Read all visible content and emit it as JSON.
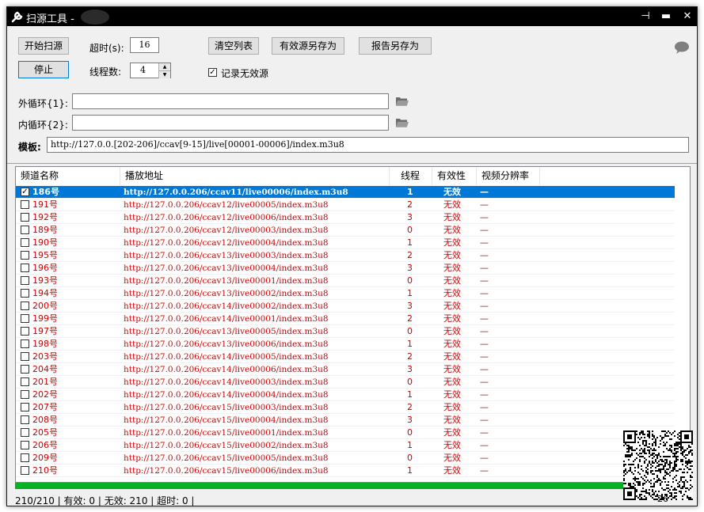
{
  "window": {
    "title": "扫源工具 -"
  },
  "titlebar_buttons": {
    "pin": "⊣",
    "minimize": "▬",
    "close": "✕"
  },
  "controls": {
    "start_label": "开始扫源",
    "stop_label": "停止",
    "timeout_label": "超时(s):",
    "timeout_value": "16",
    "threads_label": "线程数:",
    "threads_value": "4",
    "clear_label": "清空列表",
    "save_valid_label": "有效源另存为",
    "save_report_label": "报告另存为",
    "record_invalid_label": "记录无效源",
    "record_invalid_checked": true,
    "outer_loop_label": "外循环{1}:",
    "outer_loop_value": "",
    "inner_loop_label": "内循环{2}:",
    "inner_loop_value": "",
    "template_label": "模板:",
    "template_value": "http://127.0.0.[202-206]/ccav[9-15]/live[00001-00006]/index.m3u8"
  },
  "table": {
    "columns": [
      "频道名称",
      "播放地址",
      "线程",
      "有效性",
      "视频分辨率"
    ],
    "rows": [
      {
        "name": "186号",
        "url": "http://127.0.0.206/ccav11/live00006/index.m3u8",
        "thread": "1",
        "valid": "无效",
        "res": "—",
        "checked": true,
        "selected": true
      },
      {
        "name": "191号",
        "url": "http://127.0.0.206/ccav12/live00005/index.m3u8",
        "thread": "2",
        "valid": "无效",
        "res": "—"
      },
      {
        "name": "192号",
        "url": "http://127.0.0.206/ccav12/live00006/index.m3u8",
        "thread": "3",
        "valid": "无效",
        "res": "—"
      },
      {
        "name": "189号",
        "url": "http://127.0.0.206/ccav12/live00003/index.m3u8",
        "thread": "0",
        "valid": "无效",
        "res": "—"
      },
      {
        "name": "190号",
        "url": "http://127.0.0.206/ccav12/live00004/index.m3u8",
        "thread": "1",
        "valid": "无效",
        "res": "—"
      },
      {
        "name": "195号",
        "url": "http://127.0.0.206/ccav13/live00003/index.m3u8",
        "thread": "2",
        "valid": "无效",
        "res": "—"
      },
      {
        "name": "196号",
        "url": "http://127.0.0.206/ccav13/live00004/index.m3u8",
        "thread": "3",
        "valid": "无效",
        "res": "—"
      },
      {
        "name": "193号",
        "url": "http://127.0.0.206/ccav13/live00001/index.m3u8",
        "thread": "0",
        "valid": "无效",
        "res": "—"
      },
      {
        "name": "194号",
        "url": "http://127.0.0.206/ccav13/live00002/index.m3u8",
        "thread": "1",
        "valid": "无效",
        "res": "—"
      },
      {
        "name": "200号",
        "url": "http://127.0.0.206/ccav14/live00002/index.m3u8",
        "thread": "3",
        "valid": "无效",
        "res": "—"
      },
      {
        "name": "199号",
        "url": "http://127.0.0.206/ccav14/live00001/index.m3u8",
        "thread": "2",
        "valid": "无效",
        "res": "—"
      },
      {
        "name": "197号",
        "url": "http://127.0.0.206/ccav13/live00005/index.m3u8",
        "thread": "0",
        "valid": "无效",
        "res": "—"
      },
      {
        "name": "198号",
        "url": "http://127.0.0.206/ccav13/live00006/index.m3u8",
        "thread": "1",
        "valid": "无效",
        "res": "—"
      },
      {
        "name": "203号",
        "url": "http://127.0.0.206/ccav14/live00005/index.m3u8",
        "thread": "2",
        "valid": "无效",
        "res": "—"
      },
      {
        "name": "204号",
        "url": "http://127.0.0.206/ccav14/live00006/index.m3u8",
        "thread": "3",
        "valid": "无效",
        "res": "—"
      },
      {
        "name": "201号",
        "url": "http://127.0.0.206/ccav14/live00003/index.m3u8",
        "thread": "0",
        "valid": "无效",
        "res": "—"
      },
      {
        "name": "202号",
        "url": "http://127.0.0.206/ccav14/live00004/index.m3u8",
        "thread": "1",
        "valid": "无效",
        "res": "—"
      },
      {
        "name": "207号",
        "url": "http://127.0.0.206/ccav15/live00003/index.m3u8",
        "thread": "2",
        "valid": "无效",
        "res": "—"
      },
      {
        "name": "208号",
        "url": "http://127.0.0.206/ccav15/live00004/index.m3u8",
        "thread": "3",
        "valid": "无效",
        "res": "—"
      },
      {
        "name": "205号",
        "url": "http://127.0.0.206/ccav15/live00001/index.m3u8",
        "thread": "0",
        "valid": "无效",
        "res": "—"
      },
      {
        "name": "206号",
        "url": "http://127.0.0.206/ccav15/live00002/index.m3u8",
        "thread": "1",
        "valid": "无效",
        "res": "—"
      },
      {
        "name": "209号",
        "url": "http://127.0.0.206/ccav15/live00005/index.m3u8",
        "thread": "0",
        "valid": "无效",
        "res": "—"
      },
      {
        "name": "210号",
        "url": "http://127.0.0.206/ccav15/live00006/index.m3u8",
        "thread": "1",
        "valid": "无效",
        "res": "—"
      }
    ]
  },
  "progress": {
    "fraction": 1.0,
    "color": "#06b025"
  },
  "status": {
    "text": "210/210  | 有效: 0 | 无效: 210 | 超时: 0 |",
    "corner": "26"
  },
  "colors": {
    "invalid": "#d40000",
    "selection": "#0078d7"
  }
}
